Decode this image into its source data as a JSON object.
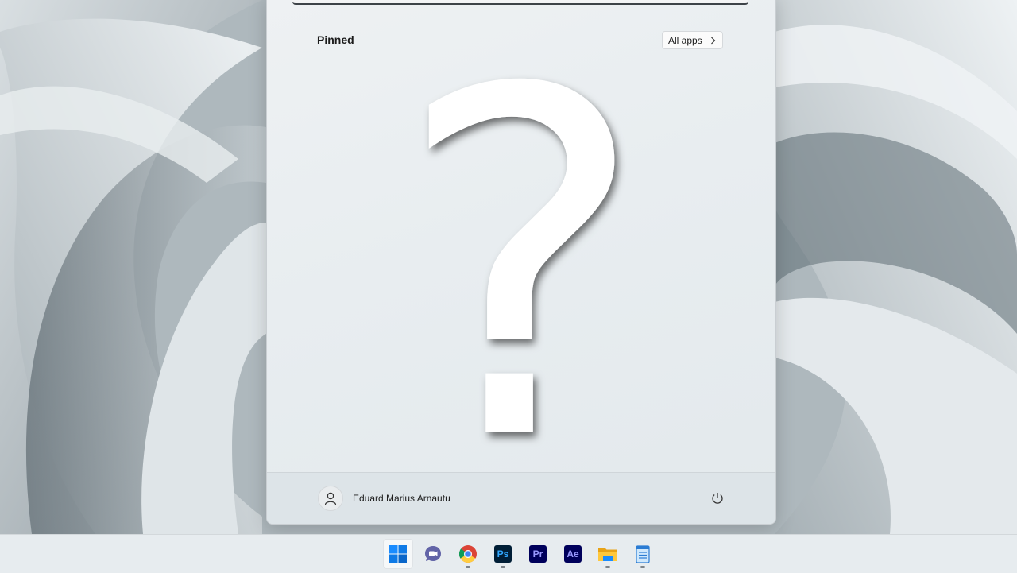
{
  "start_menu": {
    "pinned_title": "Pinned",
    "all_apps_label": "All apps",
    "placeholder_glyph": "?",
    "user_name": "Eduard Marius Arnautu"
  },
  "taskbar": {
    "items": [
      {
        "name": "start",
        "icon": "windows-logo-icon",
        "active": true,
        "running": false
      },
      {
        "name": "chat",
        "icon": "teams-chat-icon",
        "running": false
      },
      {
        "name": "chrome",
        "icon": "chrome-icon",
        "running": true
      },
      {
        "name": "photoshop",
        "icon": "photoshop-icon",
        "label": "Ps",
        "running": true
      },
      {
        "name": "premiere",
        "icon": "premiere-icon",
        "label": "Pr",
        "running": false
      },
      {
        "name": "after-effects",
        "icon": "after-effects-icon",
        "label": "Ae",
        "running": false
      },
      {
        "name": "file-explorer",
        "icon": "folder-icon",
        "running": true
      },
      {
        "name": "notepad",
        "icon": "notepad-icon",
        "running": true
      }
    ]
  },
  "colors": {
    "accent_blue": "#0078d4",
    "photoshop_text": "#31a8ff",
    "premiere_text": "#9999ff",
    "after_effects_text": "#9999ff",
    "adobe_bg": "#001e36"
  }
}
